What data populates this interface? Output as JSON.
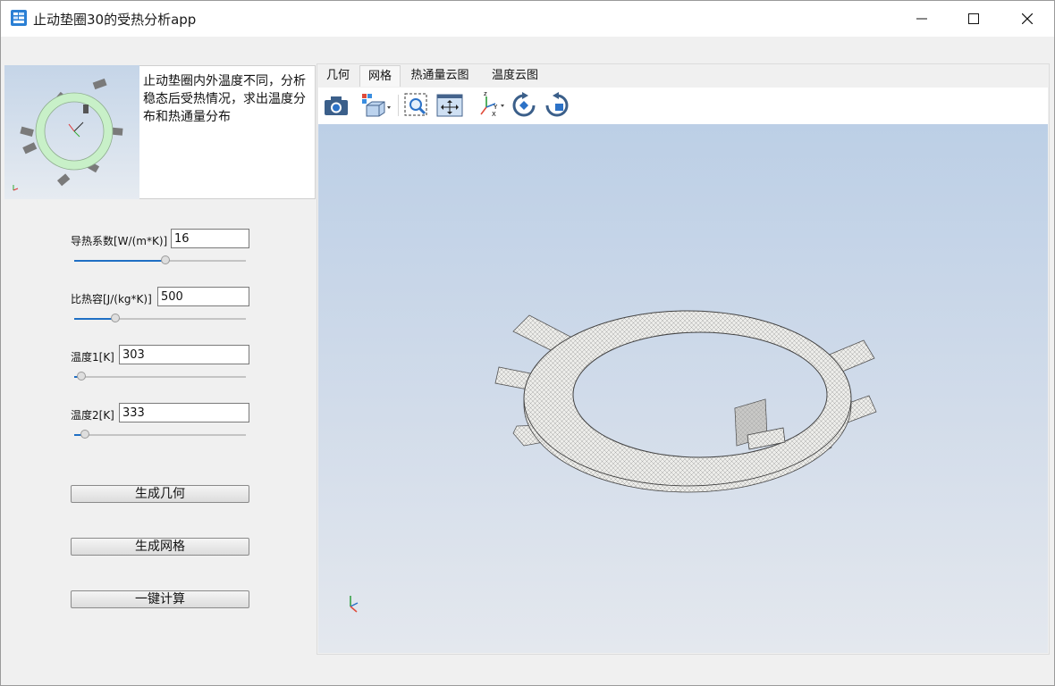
{
  "window": {
    "title": "止动垫圈30的受热分析app",
    "icon": "app-window-icon",
    "controls": [
      "minimize-icon",
      "maximize-icon",
      "close-icon"
    ]
  },
  "left_panel": {
    "description": "止动垫圈内外温度不同，分析稳态后受热情况，求出温度分布和热通量分布",
    "params": [
      {
        "label": "导热系数[W/(m*K)]",
        "value": "16",
        "slider_fraction": 0.53
      },
      {
        "label": "比热容[J/(kg*K)]",
        "value": "500",
        "slider_fraction": 0.24
      },
      {
        "label": "温度1[K]",
        "value": "303",
        "slider_fraction": 0.04
      },
      {
        "label": "温度2[K]",
        "value": "333",
        "slider_fraction": 0.06
      }
    ],
    "buttons": {
      "gen_geometry": "生成几何",
      "gen_mesh": "生成网格",
      "compute": "一键计算"
    }
  },
  "tabs": [
    {
      "label": "几何",
      "active": false
    },
    {
      "label": "网格",
      "active": true
    },
    {
      "label": "热通量云图",
      "active": false
    },
    {
      "label": "温度云图",
      "active": false
    }
  ],
  "toolbar": {
    "icons": [
      "camera-icon",
      "view-cube-icon",
      "zoom-box-icon",
      "fit-view-icon",
      "axes-orientation-icon",
      "rotate-cw-icon",
      "rotate-ccw-icon"
    ]
  },
  "colors": {
    "slider_fill": "#1f6fc4",
    "viewport_top": "#bccfe6",
    "viewport_bottom": "#e4e8ee",
    "preview_ring": "#c8f0c8"
  }
}
